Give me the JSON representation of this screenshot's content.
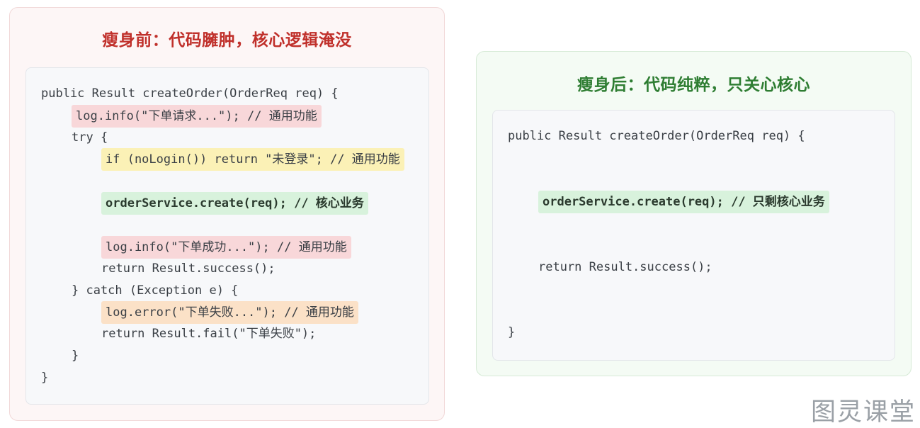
{
  "before": {
    "title": "瘦身前：代码臃肿，核心逻辑淹没",
    "lines": [
      "public Result createOrder(OrderReq req) {",
      "log.info(\"下单请求...\"); // 通用功能",
      "try {",
      "if (noLogin()) return \"未登录\"; // 通用功能",
      "orderService.create(req); // 核心业务",
      "log.info(\"下单成功...\"); // 通用功能",
      "return Result.success();",
      "} catch (Exception e) {",
      "log.error(\"下单失败...\"); // 通用功能",
      "return Result.fail(\"下单失败\");",
      "}",
      "}"
    ]
  },
  "after": {
    "title": "瘦身后：代码纯粹，只关心核心",
    "lines": [
      "public Result createOrder(OrderReq req) {",
      "orderService.create(req); // 只剩核心业务",
      "return Result.success();",
      "}"
    ]
  },
  "watermark": "图灵课堂",
  "colors": {
    "before_title": "#c0302b",
    "after_title": "#2e7d32",
    "highlight_red": "#f8d7d9",
    "highlight_yellow": "#fbf1b6",
    "highlight_green": "#d8f2dc",
    "highlight_orange": "#fbe1c7"
  }
}
